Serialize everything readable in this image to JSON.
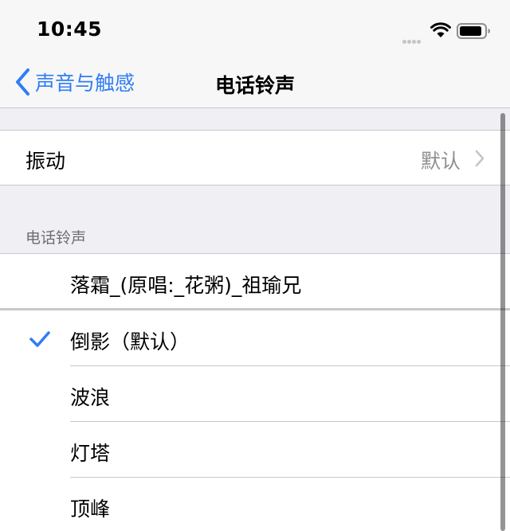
{
  "status_bar": {
    "time": "10:45",
    "signal_icon": "signal-dots-icon",
    "wifi_icon": "wifi-icon",
    "battery_icon": "battery-icon"
  },
  "nav": {
    "back_label": "声音与触感",
    "title": "电话铃声",
    "accent_color": "#2f7cf6"
  },
  "vibration": {
    "label": "振动",
    "value": "默认"
  },
  "ringtones": {
    "section_header": "电话铃声",
    "custom": [
      {
        "label": "落霜_(原唱:_花粥)_祖瑜兄"
      }
    ],
    "system": [
      {
        "label": "倒影（默认）",
        "selected": true
      },
      {
        "label": "波浪",
        "selected": false
      },
      {
        "label": "灯塔",
        "selected": false
      },
      {
        "label": "顶峰",
        "selected": false
      }
    ]
  }
}
